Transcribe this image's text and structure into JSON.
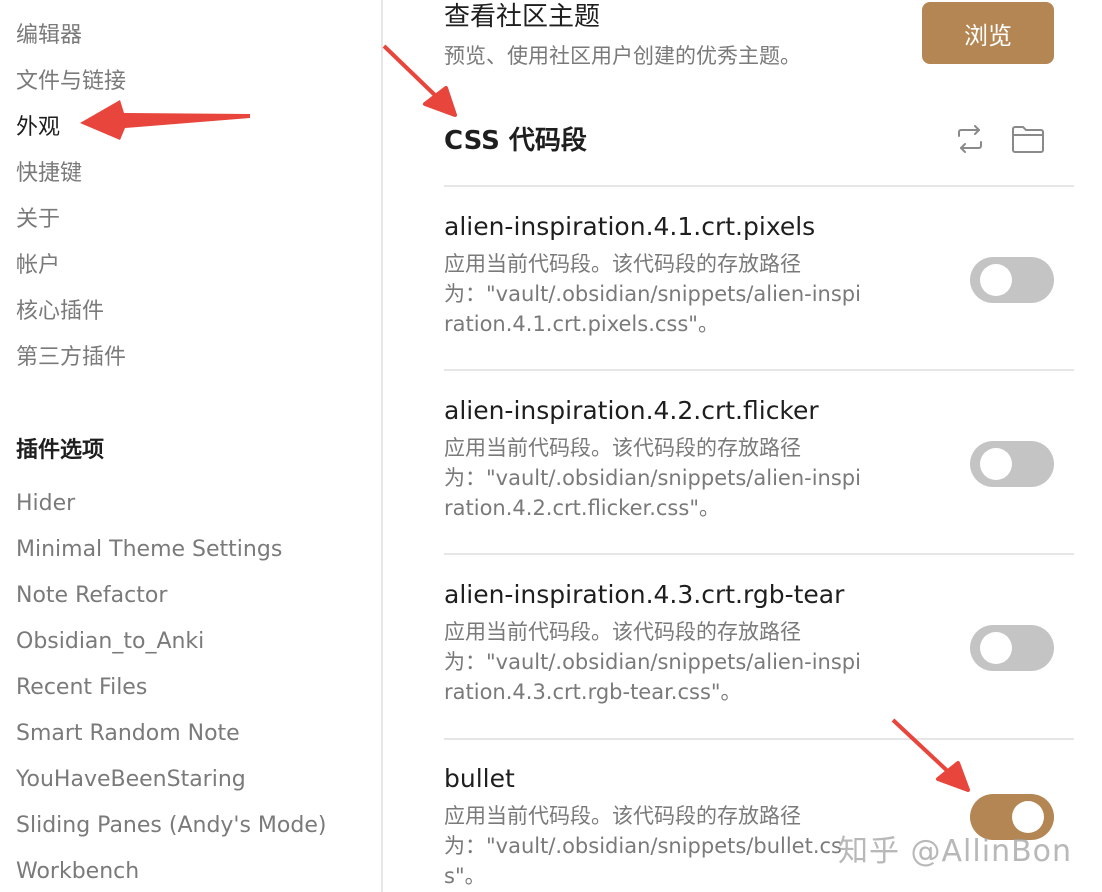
{
  "sidebar": {
    "items": [
      {
        "label": "编辑器"
      },
      {
        "label": "文件与链接"
      },
      {
        "label": "外观"
      },
      {
        "label": "快捷键"
      },
      {
        "label": "关于"
      },
      {
        "label": "帐户"
      },
      {
        "label": "核心插件"
      },
      {
        "label": "第三方插件"
      }
    ],
    "plugin_header": "插件选项",
    "plugins": [
      {
        "label": "Hider"
      },
      {
        "label": "Minimal Theme Settings"
      },
      {
        "label": "Note Refactor"
      },
      {
        "label": "Obsidian_to_Anki"
      },
      {
        "label": "Recent Files"
      },
      {
        "label": "Smart Random Note"
      },
      {
        "label": "YouHaveBeenStaring"
      },
      {
        "label": "Sliding Panes (Andy's Mode)"
      },
      {
        "label": "Workbench"
      }
    ]
  },
  "browse": {
    "title": "查看社区主题",
    "description": "预览、使用社区用户创建的优秀主题。",
    "button_label": "浏览"
  },
  "css_section": {
    "title": "CSS 代码段",
    "icons": [
      "reload-icon",
      "folder-icon"
    ]
  },
  "snippets": [
    {
      "name": "alien-inspiration.4.1.crt.pixels",
      "description": "应用当前代码段。该代码段的存放路径为：\"vault/.obsidian/snippets/alien-inspiration.4.1.crt.pixels.css\"。",
      "enabled": false
    },
    {
      "name": "alien-inspiration.4.2.crt.flicker",
      "description": "应用当前代码段。该代码段的存放路径为：\"vault/.obsidian/snippets/alien-inspiration.4.2.crt.flicker.css\"。",
      "enabled": false
    },
    {
      "name": "alien-inspiration.4.3.crt.rgb-tear",
      "description": "应用当前代码段。该代码段的存放路径为：\"vault/.obsidian/snippets/alien-inspiration.4.3.crt.rgb-tear.css\"。",
      "enabled": false
    },
    {
      "name": "bullet",
      "description": "应用当前代码段。该代码段的存放路径为：\"vault/.obsidian/snippets/bullet.css\"。",
      "enabled": true
    }
  ],
  "colors": {
    "accent": "#b48653",
    "toggle_off": "#c4c4c4",
    "annotation_arrow": "#e8453c"
  },
  "watermark": "知乎 @AllinBon"
}
